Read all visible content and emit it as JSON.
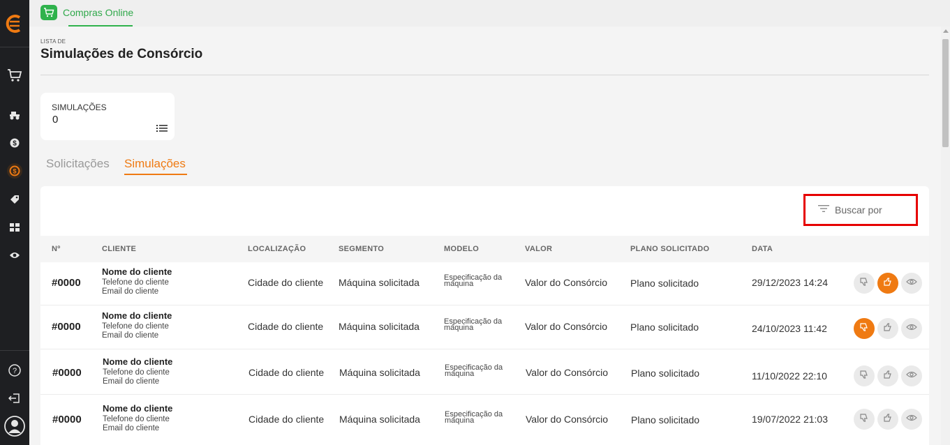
{
  "app": {
    "name": "Compras Online",
    "accent": "#ef7a12",
    "brand_green": "#2fb24c"
  },
  "page": {
    "kicker": "LISTA DE",
    "title": "Simulações de Consórcio"
  },
  "stats": {
    "label": "SIMULAÇÕES",
    "value": "0"
  },
  "tabs": [
    {
      "label": "Solicitações",
      "active": false
    },
    {
      "label": "Simulações",
      "active": true
    }
  ],
  "search": {
    "label": "Buscar por"
  },
  "table": {
    "headers": [
      "Nº",
      "CLIENTE",
      "LOCALIZAÇÃO",
      "SEGMENTO",
      "MODELO",
      "VALOR",
      "PLANO SOLICITADO",
      "DATA"
    ],
    "rows": [
      {
        "num": "#0000",
        "name": "Nome do cliente",
        "phone": "Telefone do cliente",
        "email": "Email do cliente",
        "location": "Cidade do cliente",
        "segment": "Máquina solicitada",
        "model_line1": "Especificação da",
        "model_line2": "máquina",
        "value": "Valor do Consórcio",
        "plan": "Plano solicitado",
        "date": "29/12/2023 14:24",
        "status": "approved"
      },
      {
        "num": "#0000",
        "name": "Nome do cliente",
        "phone": "Telefone do cliente",
        "email": "Email do cliente",
        "location": "Cidade do cliente",
        "segment": "Máquina solicitada",
        "model_line1": "Especificação da",
        "model_line2": "máquina",
        "value": "Valor do Consórcio",
        "plan": "Plano solicitado",
        "date": "24/10/2023 11:42",
        "status": "rejected"
      },
      {
        "num": "#0000",
        "name": "Nome do cliente",
        "phone": "Telefone do cliente",
        "email": "Email do cliente",
        "location": "Cidade do cliente",
        "segment": "Máquina solicitada",
        "model_line1": "Especificação da",
        "model_line2": "máquina",
        "value": "Valor do Consórcio",
        "plan": "Plano solicitado",
        "date": "11/10/2022 22:10",
        "status": "none"
      },
      {
        "num": "#0000",
        "name": "Nome do cliente",
        "phone": "Telefone do cliente",
        "email": "Email do cliente",
        "location": "Cidade do cliente",
        "segment": "Máquina solicitada",
        "model_line1": "Especificação da",
        "model_line2": "máquina",
        "value": "Valor do Consórcio",
        "plan": "Plano solicitado",
        "date": "19/07/2022 21:03",
        "status": "none"
      }
    ]
  },
  "sidebar": {
    "icons": [
      "cart-icon",
      "tractor-icon",
      "dollar-icon",
      "consortium-icon",
      "tag-icon",
      "grid-icon",
      "eye-icon",
      "help-icon",
      "logout-icon",
      "user-icon"
    ]
  }
}
